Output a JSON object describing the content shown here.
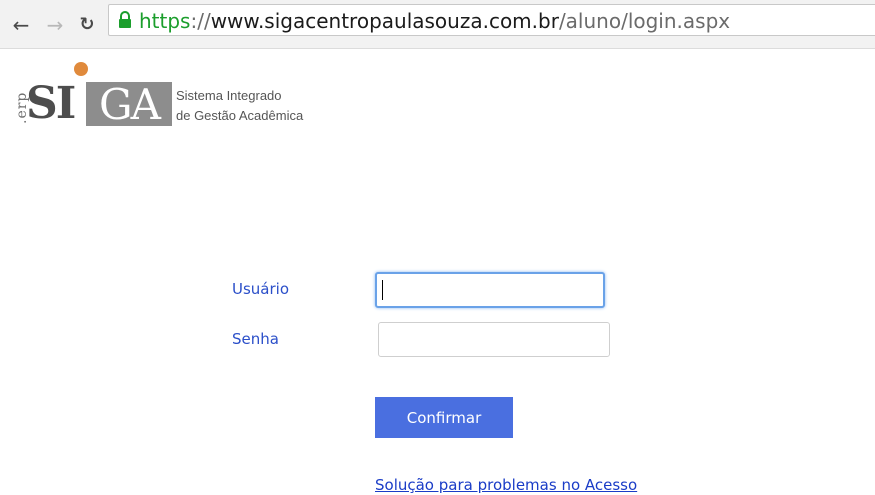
{
  "browser": {
    "url": {
      "scheme": "https",
      "separator": "://",
      "host": "www.sigacentropaulasouza.com.br",
      "path": "/aluno/login.aspx"
    },
    "icons": {
      "back": "arrow-back-icon",
      "forward": "arrow-forward-icon",
      "reload": "reload-icon",
      "lock": "lock-icon"
    }
  },
  "logo": {
    "erp": ".erp",
    "si": "SI",
    "ga": "GA",
    "line1": "Sistema Integrado",
    "line2": "de Gestão Acadêmica",
    "accent_color": "#e08a3c"
  },
  "login": {
    "user_label": "Usuário",
    "user_value": "",
    "password_label": "Senha",
    "password_value": "",
    "confirm_label": "Confirmar",
    "help_link": "Solução para problemas no Acesso"
  },
  "colors": {
    "button": "#4a6fe0",
    "label": "#2b4fc9",
    "link": "#1a3cc7",
    "focus_border": "#6aa2e8",
    "secure_scheme": "#1b9e2c"
  }
}
